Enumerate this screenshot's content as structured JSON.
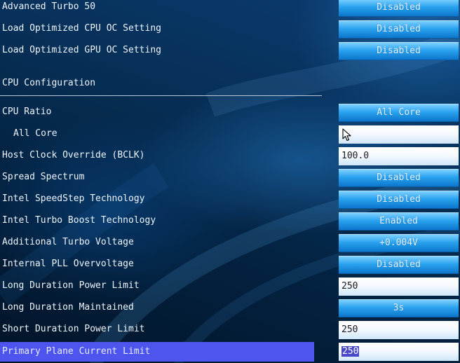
{
  "colors": {
    "background": "#052a52",
    "button_accent": "#2aa3ef",
    "highlight": "#4d55ee",
    "selection": "#4747c9"
  },
  "section_title": "CPU Configuration",
  "settings": [
    {
      "label": "Advanced Turbo 50",
      "value": "Disabled",
      "control": "button"
    },
    {
      "label": "Load Optimized CPU OC Setting",
      "value": "Disabled",
      "control": "button"
    },
    {
      "label": "Load Optimized GPU OC Setting",
      "value": "Disabled",
      "control": "button"
    },
    {
      "label": "CPU Ratio",
      "value": "All Core",
      "control": "button"
    },
    {
      "label": "All Core",
      "value": "",
      "control": "field"
    },
    {
      "label": "Host Clock Override (BCLK)",
      "value": "100.0",
      "control": "field"
    },
    {
      "label": "Spread Spectrum",
      "value": "Disabled",
      "control": "button"
    },
    {
      "label": "Intel SpeedStep Technology",
      "value": "Disabled",
      "control": "button"
    },
    {
      "label": "Intel Turbo Boost Technology",
      "value": "Enabled",
      "control": "button"
    },
    {
      "label": "Additional Turbo Voltage",
      "value": "+0.004V",
      "control": "button"
    },
    {
      "label": "Internal PLL Overvoltage",
      "value": "Disabled",
      "control": "button"
    },
    {
      "label": "Long Duration Power Limit",
      "value": "250",
      "control": "field"
    },
    {
      "label": "Long Duration Maintained",
      "value": "3s",
      "control": "button"
    },
    {
      "label": "Short Duration Power Limit",
      "value": "250",
      "control": "field"
    },
    {
      "label": "Primary Plane Current Limit",
      "value": "250",
      "control": "field",
      "selected": true
    }
  ],
  "cursor_icon": "mouse-pointer-icon"
}
